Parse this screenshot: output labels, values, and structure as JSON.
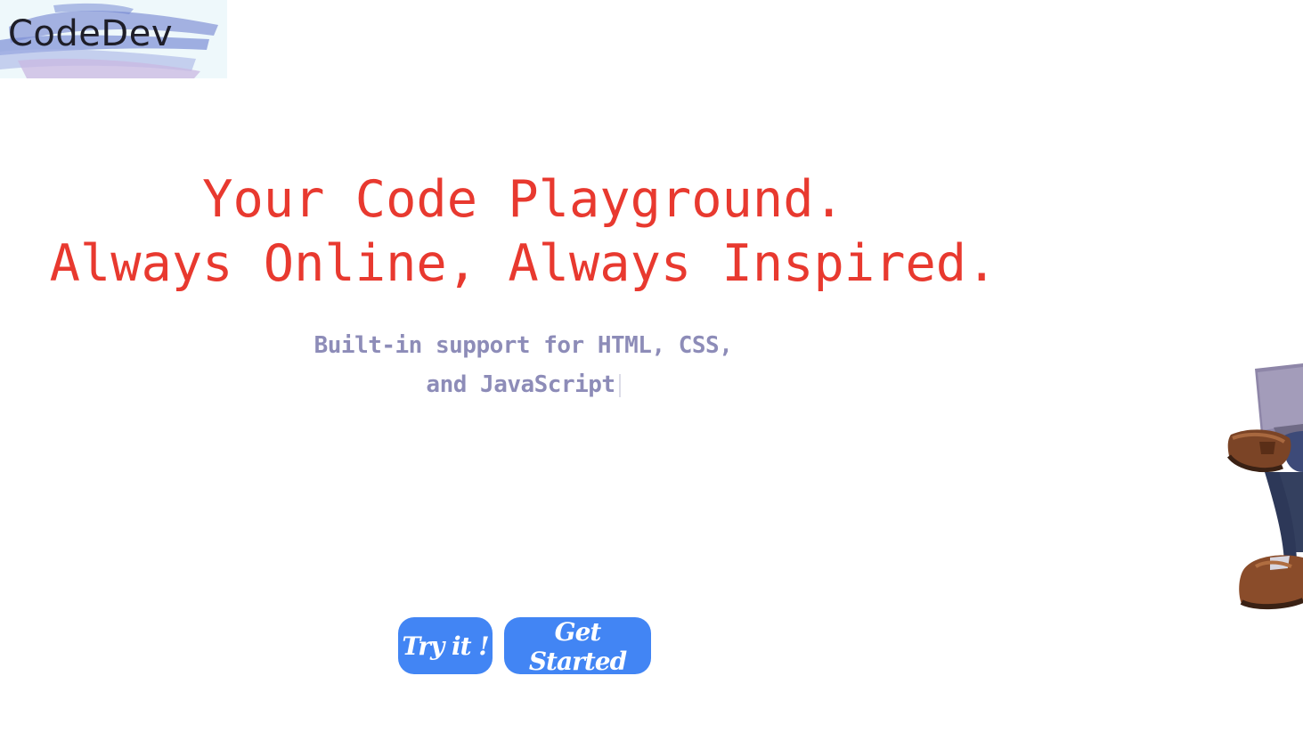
{
  "brand": {
    "logo_text": "CodeDev"
  },
  "hero": {
    "headline_line1": "Your Code Playground.",
    "headline_line2": "Always Online, Always Inspired.",
    "subtext_line1": "Built-in support for HTML, CSS,",
    "subtext_line2": "and JavaScript"
  },
  "actions": {
    "try_label": "Try it !",
    "start_label": "Get Started"
  },
  "colors": {
    "headline": "#e8392f",
    "subtext": "#8d8cb8",
    "button": "#4285f4"
  },
  "icons": {
    "illustration": "person-with-laptop-illustration"
  }
}
